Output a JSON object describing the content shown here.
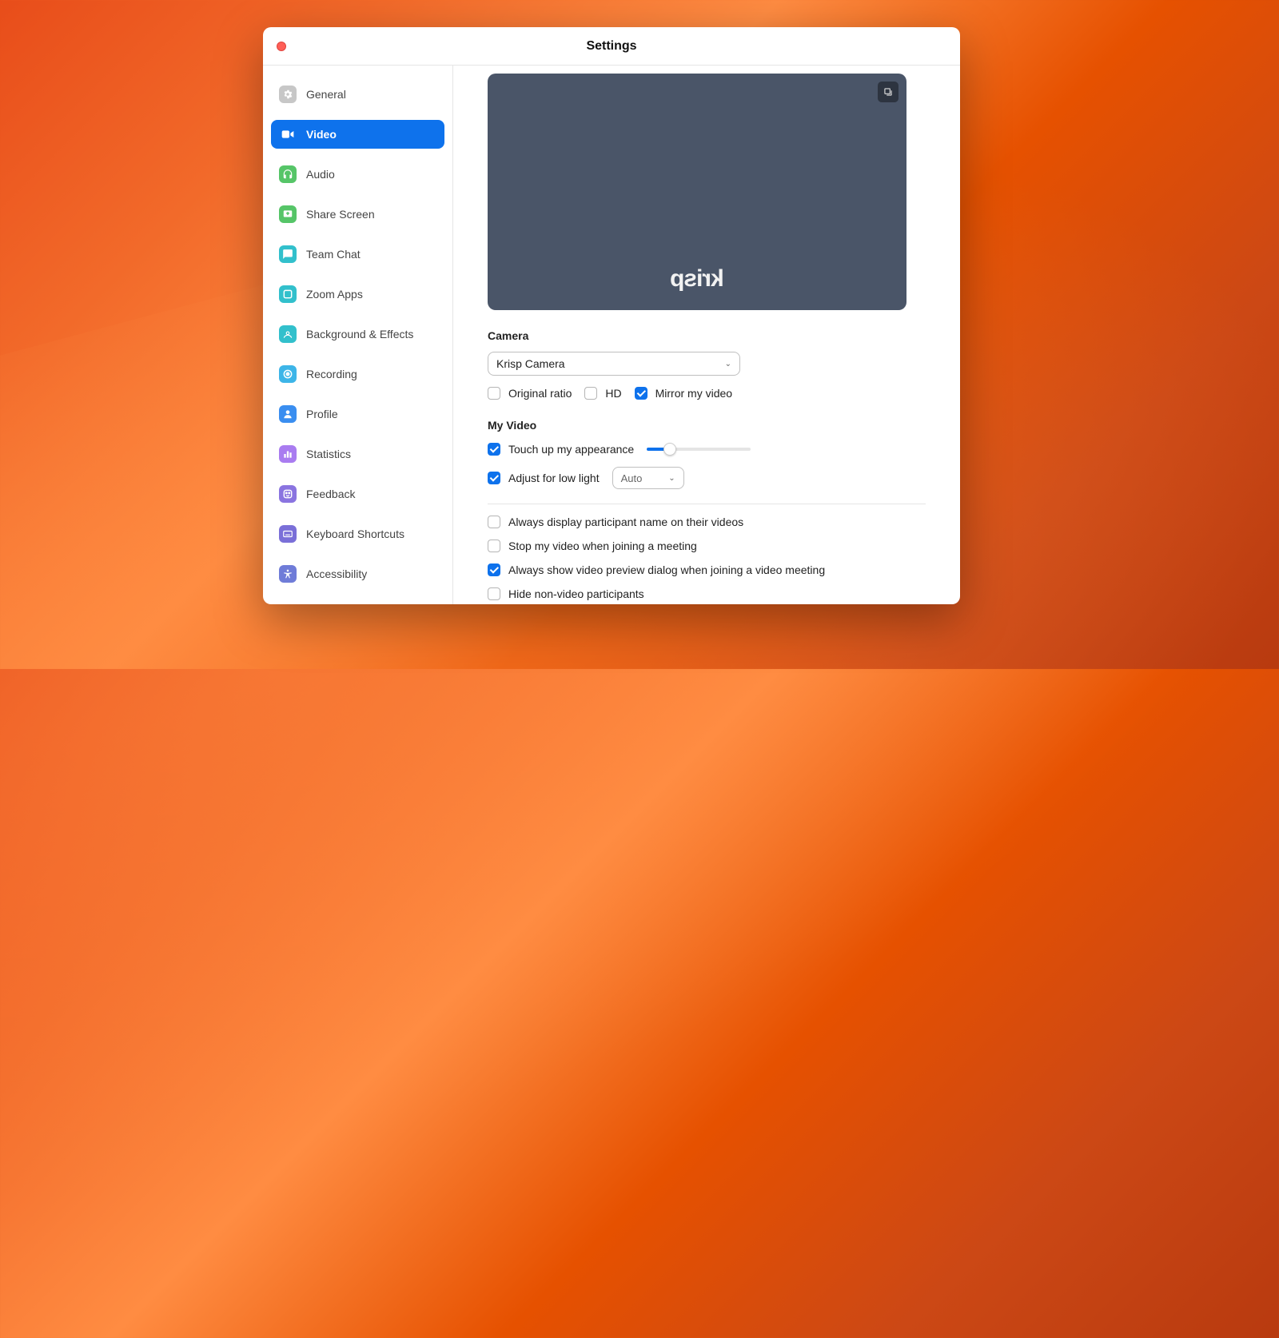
{
  "window": {
    "title": "Settings"
  },
  "sidebar": {
    "items": [
      {
        "label": "General",
        "color": "#c7c7c7"
      },
      {
        "label": "Video",
        "color": "#0e72ec",
        "active": true
      },
      {
        "label": "Audio",
        "color": "#56c568"
      },
      {
        "label": "Share Screen",
        "color": "#56c568"
      },
      {
        "label": "Team Chat",
        "color": "#32c0cc"
      },
      {
        "label": "Zoom Apps",
        "color": "#32c0cc"
      },
      {
        "label": "Background & Effects",
        "color": "#32c0cc"
      },
      {
        "label": "Recording",
        "color": "#3db5e8"
      },
      {
        "label": "Profile",
        "color": "#3a8ef0"
      },
      {
        "label": "Statistics",
        "color": "#a97cf0"
      },
      {
        "label": "Feedback",
        "color": "#8a74e0"
      },
      {
        "label": "Keyboard Shortcuts",
        "color": "#7a6fd8"
      },
      {
        "label": "Accessibility",
        "color": "#6f7cd8"
      }
    ]
  },
  "video": {
    "preview_logo": "krisp",
    "camera_section": "Camera",
    "camera_selected": "Krisp Camera",
    "original_ratio": {
      "label": "Original ratio",
      "checked": false
    },
    "hd": {
      "label": "HD",
      "checked": false
    },
    "mirror": {
      "label": "Mirror my video",
      "checked": true
    },
    "my_video_section": "My Video",
    "touch_up": {
      "label": "Touch up my appearance",
      "checked": true,
      "slider_pct": 22
    },
    "low_light": {
      "label": "Adjust for low light",
      "checked": true,
      "mode": "Auto"
    },
    "opts": {
      "display_name": {
        "label": "Always display participant name on their videos",
        "checked": false
      },
      "stop_video": {
        "label": "Stop my video when joining a meeting",
        "checked": false
      },
      "preview_dialog": {
        "label": "Always show video preview dialog when joining a video meeting",
        "checked": true
      },
      "hide_nonvideo": {
        "label": "Hide non-video participants",
        "checked": false
      }
    }
  }
}
